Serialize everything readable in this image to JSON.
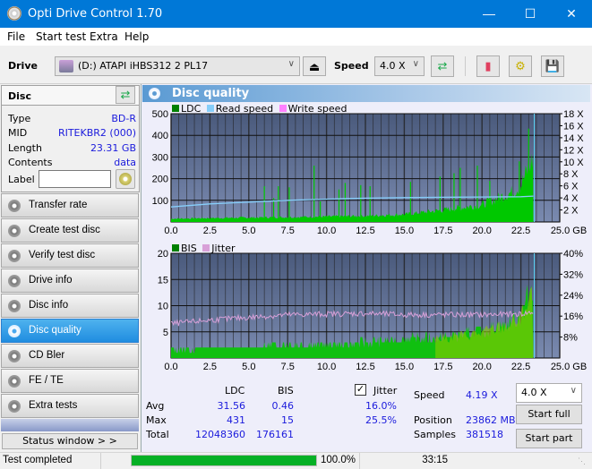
{
  "window": {
    "title": "Opti Drive Control 1.70",
    "minimize": "—",
    "maximize": "☐",
    "close": "✕"
  },
  "menu": [
    "File",
    "Start test",
    "Extra",
    "Help"
  ],
  "toolbar": {
    "drive_label": "Drive",
    "drive_value": "(D:)  ATAPI iHBS312   2 PL17",
    "speed_label": "Speed",
    "speed_value": "4.0 X",
    "icons": [
      "eject-icon",
      "refresh-icon",
      "eraser-icon",
      "settings-icon",
      "save-icon"
    ]
  },
  "disc": {
    "header": "Disc",
    "rows": [
      {
        "label": "Type",
        "value": "BD-R"
      },
      {
        "label": "MID",
        "value": "RITEKBR2 (000)"
      },
      {
        "label": "Length",
        "value": "23.31 GB"
      },
      {
        "label": "Contents",
        "value": "data"
      }
    ],
    "label_field_label": "Label",
    "label_field_value": ""
  },
  "nav": [
    {
      "label": "Transfer rate",
      "active": false
    },
    {
      "label": "Create test disc",
      "active": false
    },
    {
      "label": "Verify test disc",
      "active": false
    },
    {
      "label": "Drive info",
      "active": false
    },
    {
      "label": "Disc info",
      "active": false
    },
    {
      "label": "Disc quality",
      "active": true
    },
    {
      "label": "CD Bler",
      "active": false
    },
    {
      "label": "FE / TE",
      "active": false
    },
    {
      "label": "Extra tests",
      "active": false
    }
  ],
  "status_window_button": "Status window > >",
  "panel": {
    "title": "Disc quality"
  },
  "chart_data": [
    {
      "type": "area",
      "title": "LDC / Read speed",
      "legend": [
        "LDC",
        "Read speed",
        "Write speed"
      ],
      "colors": {
        "LDC": "#00c800",
        "Read speed": "#87cefa",
        "Write speed": "#ff80ff"
      },
      "xlabel": "GB",
      "xlim": [
        0,
        25
      ],
      "x_ticks": [
        "0.0",
        "2.5",
        "5.0",
        "7.5",
        "10.0",
        "12.5",
        "15.0",
        "17.5",
        "20.0",
        "22.5",
        "25.0 GB"
      ],
      "ylim": [
        0,
        500
      ],
      "y_ticks": [
        "100",
        "200",
        "300",
        "400",
        "500"
      ],
      "y2lim": [
        0,
        18
      ],
      "y2_ticks": [
        "2 X",
        "4 X",
        "6 X",
        "8 X",
        "10 X",
        "12 X",
        "14 X",
        "16 X",
        "18 X"
      ],
      "series": [
        {
          "name": "LDC (baseline)",
          "x": [
            0,
            2.5,
            5,
            7.5,
            10,
            12.5,
            15,
            17.5,
            20,
            21,
            22,
            22.5,
            23,
            23.3
          ],
          "values": [
            15,
            18,
            20,
            22,
            25,
            28,
            35,
            55,
            80,
            110,
            140,
            170,
            250,
            300
          ]
        },
        {
          "name": "LDC spikes",
          "x": [
            6,
            6.6,
            6.9,
            7.6,
            9.2,
            9.6,
            10.8,
            11.2,
            12.2,
            12.8,
            15.4,
            17.3,
            18.2,
            18.6,
            19.7,
            20.5,
            22.4,
            23.0
          ],
          "values": [
            165,
            110,
            165,
            160,
            260,
            95,
            150,
            180,
            170,
            165,
            185,
            210,
            225,
            250,
            260,
            190,
            280,
            431
          ]
        },
        {
          "name": "Read speed",
          "x": [
            0,
            2.5,
            5,
            7.5,
            10,
            12.5,
            15,
            17.5,
            20,
            22.5,
            23.3
          ],
          "values": [
            2.5,
            3.0,
            3.3,
            3.6,
            3.8,
            3.95,
            4.05,
            4.1,
            4.15,
            4.19,
            4.3
          ]
        }
      ]
    },
    {
      "type": "area",
      "title": "BIS / Jitter",
      "legend": [
        "BIS",
        "Jitter"
      ],
      "colors": {
        "BIS": "#00c800",
        "Jitter": "#d8a0d8"
      },
      "xlabel": "GB",
      "xlim": [
        0,
        25
      ],
      "x_ticks": [
        "0.0",
        "2.5",
        "5.0",
        "7.5",
        "10.0",
        "12.5",
        "15.0",
        "17.5",
        "20.0",
        "22.5",
        "25.0 GB"
      ],
      "ylim": [
        0,
        20
      ],
      "y_ticks": [
        "5",
        "10",
        "15",
        "20"
      ],
      "y2lim": [
        0,
        40
      ],
      "y2_ticks": [
        "8%",
        "16%",
        "24%",
        "32%",
        "40%"
      ],
      "series": [
        {
          "name": "BIS",
          "x": [
            0,
            2.5,
            5,
            7.5,
            10,
            12.5,
            15,
            17.5,
            20,
            21,
            22,
            22.5,
            23,
            23.3
          ],
          "values": [
            1.5,
            2,
            2,
            2.5,
            2.5,
            3,
            3.5,
            4,
            5,
            6,
            7,
            8,
            12,
            15
          ]
        },
        {
          "name": "Jitter (%)",
          "x": [
            0,
            2.5,
            5,
            7.5,
            10,
            12.5,
            15,
            17.5,
            20,
            22.5,
            23.3
          ],
          "values": [
            13.0,
            14.5,
            15.5,
            16.5,
            16.8,
            17.0,
            16.5,
            16.5,
            16.5,
            16.8,
            17.5
          ]
        }
      ]
    }
  ],
  "stats": {
    "col_ldc": "LDC",
    "col_bis": "BIS",
    "jitter_checked": true,
    "jitter_label": "Jitter",
    "rows": [
      {
        "label": "Avg",
        "ldc": "31.56",
        "bis": "0.46",
        "jitter": "16.0%"
      },
      {
        "label": "Max",
        "ldc": "431",
        "bis": "15",
        "jitter": "25.5%"
      },
      {
        "label": "Total",
        "ldc": "12048360",
        "bis": "176161",
        "jitter": ""
      }
    ],
    "speed_label": "Speed",
    "speed_value": "4.19 X",
    "speed_select": "4.0 X",
    "position_label": "Position",
    "position_value": "23862 MB",
    "samples_label": "Samples",
    "samples_value": "381518",
    "start_full": "Start full",
    "start_part": "Start part"
  },
  "status": {
    "text": "Test completed",
    "progress": 100.0,
    "progress_text": "100.0%",
    "time": "33:15"
  }
}
